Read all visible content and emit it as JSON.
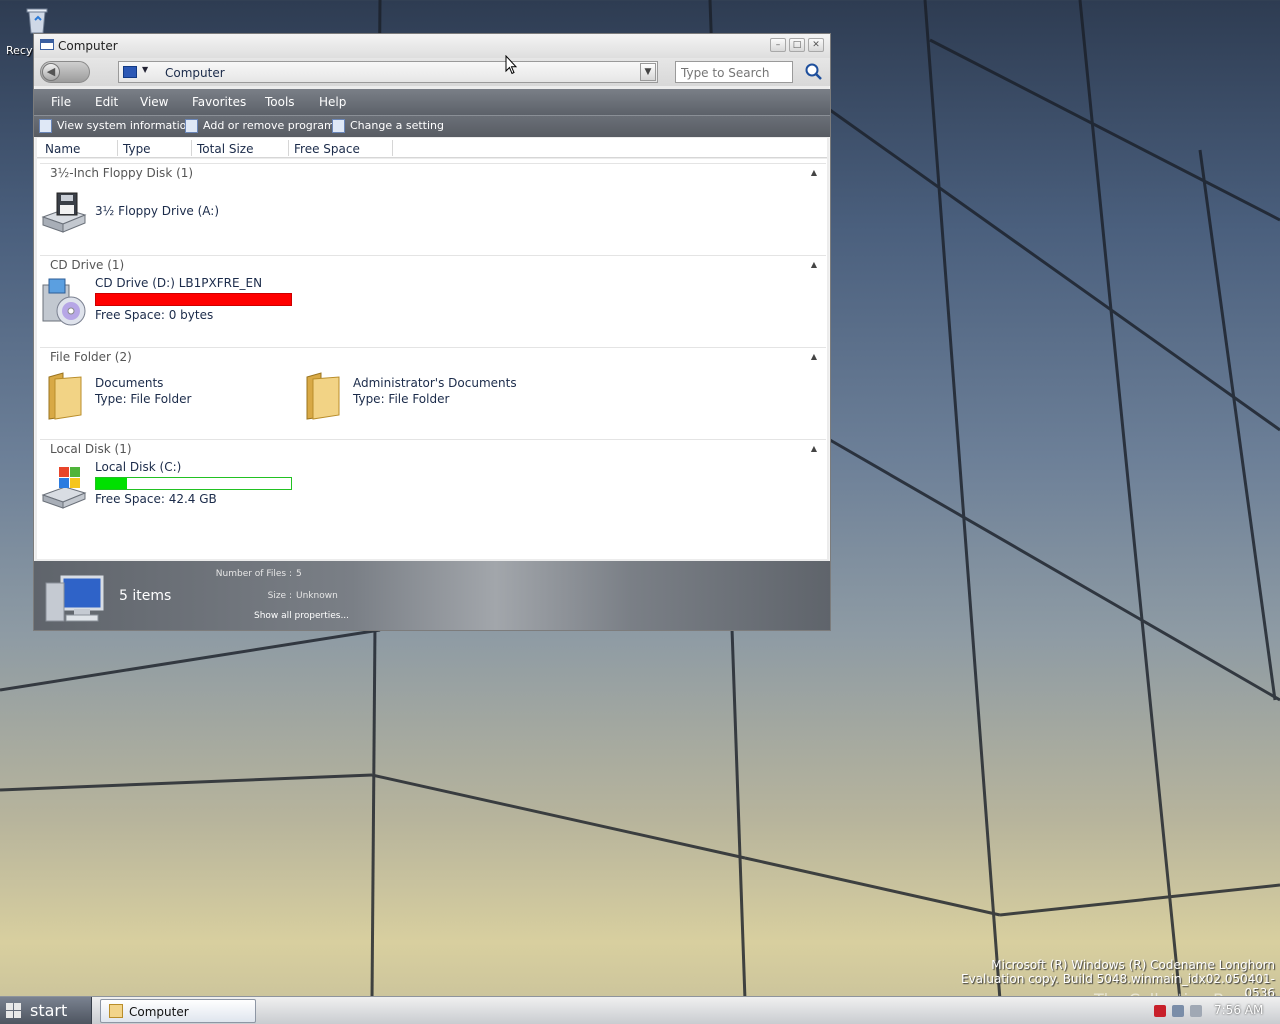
{
  "desktop": {
    "recycle_label": "Recy",
    "watermark_line1": "Microsoft (R) Windows (R) Codename Longhorn",
    "watermark_line2": "Evaluation copy. Build 5048.winmain_idx02.050401-0536",
    "brand_mark": "The Collection Book"
  },
  "window": {
    "title": "Computer",
    "address": "Computer",
    "search_placeholder": "Type to Search",
    "menu": [
      "File",
      "Edit",
      "View",
      "Favorites",
      "Tools",
      "Help"
    ],
    "tasks": [
      "View system information",
      "Add or remove programs",
      "Change a setting"
    ],
    "columns": [
      "Name",
      "Type",
      "Total Size",
      "Free Space"
    ],
    "groups": {
      "floppy": {
        "header": "3½-Inch Floppy Disk (1)",
        "item": "3½ Floppy Drive (A:)"
      },
      "cd": {
        "header": "CD Drive (1)",
        "item": "CD Drive (D:) LB1PXFRE_EN",
        "free": "Free Space: 0 bytes",
        "used_fraction": 1.0
      },
      "folders": {
        "header": "File Folder (2)",
        "items": [
          {
            "name": "Documents",
            "type": "Type: File Folder"
          },
          {
            "name": "Administrator's Documents",
            "type": "Type: File Folder"
          }
        ]
      },
      "local": {
        "header": "Local Disk (1)",
        "item": "Local Disk (C:)",
        "free": "Free Space: 42.4 GB",
        "used_fraction": 0.16
      }
    },
    "details": {
      "count": "5 items",
      "props": [
        {
          "label": "Number of Files",
          "value": "5"
        },
        {
          "label": "Size",
          "value": "Unknown"
        }
      ],
      "show_all": "Show all properties..."
    }
  },
  "taskbar": {
    "start": "start",
    "items": [
      "Computer"
    ],
    "clock": "7:56 AM"
  },
  "colors": {
    "cd_bar": "#ff0000",
    "disk_bar": "#00e000",
    "bar_border": "#22c122"
  }
}
